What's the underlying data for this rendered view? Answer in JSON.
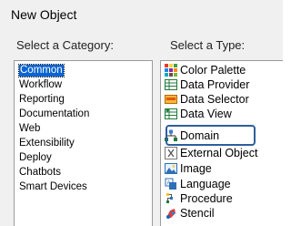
{
  "window": {
    "title": "New Object"
  },
  "category": {
    "label": "Select a Category:",
    "items": [
      "Common",
      "Workflow",
      "Reporting",
      "Documentation",
      "Web",
      "Extensibility",
      "Deploy",
      "Chatbots",
      "Smart Devices"
    ],
    "selected": "Common"
  },
  "type": {
    "label": "Select a Type:",
    "items": [
      {
        "label": "Color Palette",
        "icon": "color-palette-icon"
      },
      {
        "label": "Data Provider",
        "icon": "data-provider-icon"
      },
      {
        "label": "Data Selector",
        "icon": "data-selector-icon"
      },
      {
        "label": "Data View",
        "icon": "data-view-icon"
      },
      {
        "label": "Domain",
        "icon": "domain-icon"
      },
      {
        "label": "External Object",
        "icon": "external-object-icon"
      },
      {
        "label": "Image",
        "icon": "image-icon"
      },
      {
        "label": "Language",
        "icon": "language-icon"
      },
      {
        "label": "Procedure",
        "icon": "procedure-icon"
      },
      {
        "label": "Stencil",
        "icon": "stencil-icon"
      }
    ],
    "highlighted": "Domain"
  },
  "colors": {
    "selection": "#0a64d2",
    "focus_border": "#2e5f9c",
    "dialog_bg": "#f0f0f0"
  }
}
